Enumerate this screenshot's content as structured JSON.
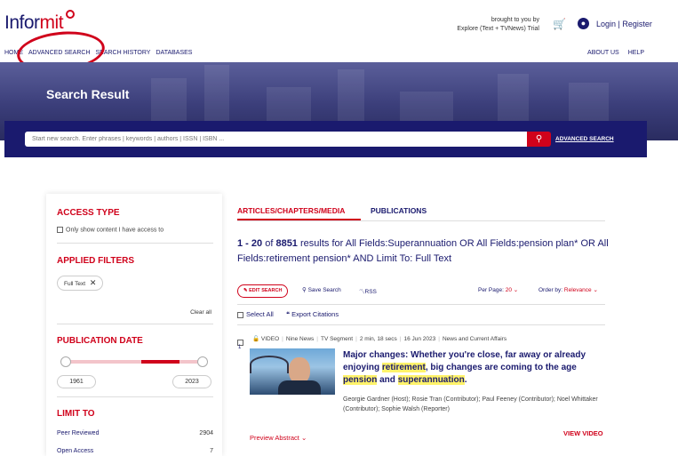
{
  "header": {
    "logo_main": "Infor",
    "logo_accent": "mit",
    "brought_line1": "brought to you by",
    "brought_line2": "Explore (Text + TVNews) Trial",
    "login_register": "Login | Register",
    "nav_items": [
      "HOME",
      "ADVANCED SEARCH",
      "SEARCH HISTORY",
      "DATABASES"
    ],
    "nav_right": [
      "ABOUT US",
      "HELP"
    ]
  },
  "hero": {
    "title": "Search Result",
    "search_placeholder": "Start new search. Enter phrases | keywords | authors | ISSN | ISBN ...",
    "advanced_search": "ADVANCED SEARCH"
  },
  "sidebar": {
    "access_type": "ACCESS TYPE",
    "access_option": "Only show content I have access to",
    "applied_filters": "APPLIED FILTERS",
    "chip": "Full Text",
    "clear_all": "Clear all",
    "publication_date": "PUBLICATION DATE",
    "year_from": "1961",
    "year_to": "2023",
    "limit_to": "LIMIT TO",
    "limits": [
      {
        "label": "Peer Reviewed",
        "count": "2904"
      },
      {
        "label": "Open Access",
        "count": "7"
      }
    ]
  },
  "main": {
    "tab_active": "ARTICLES/CHAPTERS/MEDIA",
    "tab_other": "PUBLICATIONS",
    "results_range": "1 - 20",
    "results_of": "of",
    "results_total": "8851",
    "results_query": "results for All Fields:Superannuation OR All Fields:pension plan* OR All Fields:retirement pension* AND Limit To: Full Text",
    "edit_search": "EDIT SEARCH",
    "save_search": "Save Search",
    "rss": "RSS",
    "per_page_label": "Per Page:",
    "per_page_value": "20",
    "order_by_label": "Order by:",
    "order_by_value": "Relevance",
    "select_all": "Select All",
    "export_citations": "Export Citations"
  },
  "item": {
    "number": "1",
    "type": "VIDEO",
    "source": "Nine News",
    "segment": "TV Segment",
    "duration": "2 min, 18 secs",
    "date": "16 Jun 2023",
    "category": "News and Current Affairs",
    "title_part1": "Major changes: Whether you're close, far away or already enjoying ",
    "title_hl1": "retirement",
    "title_part2": ", big changes are coming to the age ",
    "title_hl2": "pension",
    "title_part3": " and ",
    "title_hl3": "superannuation",
    "title_part4": ".",
    "authors": "Georgie Gardner (Host); Rosie Tran (Contributor); Paul Feeney (Contributor); Noel Whittaker (Contributor); Sophie Walsh (Reporter)",
    "preview_abstract": "Preview Abstract",
    "view_video": "VIEW VIDEO"
  },
  "colors": {
    "brand_red": "#d0021b",
    "brand_navy": "#1a1a6e",
    "highlight": "#fff36b"
  }
}
